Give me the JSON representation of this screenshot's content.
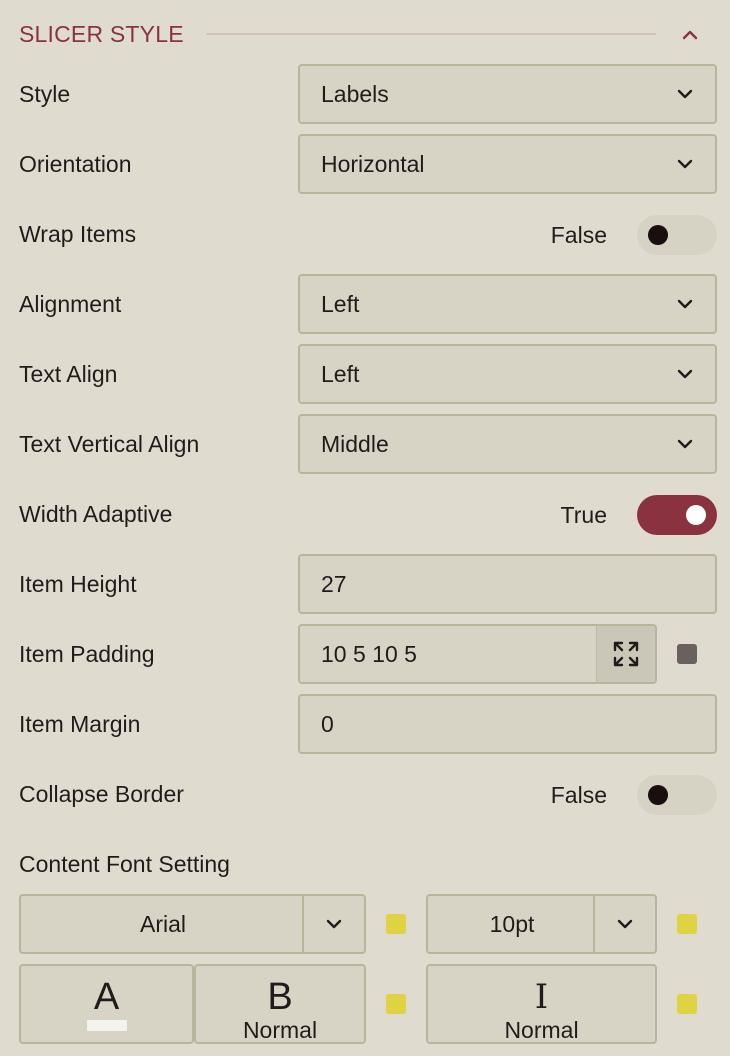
{
  "section": {
    "title": "SLICER STYLE"
  },
  "rows": {
    "style": {
      "label": "Style",
      "value": "Labels"
    },
    "orientation": {
      "label": "Orientation",
      "value": "Horizontal"
    },
    "wrap_items": {
      "label": "Wrap Items",
      "value": "False",
      "on": false
    },
    "alignment": {
      "label": "Alignment",
      "value": "Left"
    },
    "text_align": {
      "label": "Text Align",
      "value": "Left"
    },
    "text_vertical_align": {
      "label": "Text Vertical Align",
      "value": "Middle"
    },
    "width_adaptive": {
      "label": "Width Adaptive",
      "value": "True",
      "on": true
    },
    "item_height": {
      "label": "Item Height",
      "value": "27"
    },
    "item_padding": {
      "label": "Item Padding",
      "value": "10 5 10 5"
    },
    "item_margin": {
      "label": "Item Margin",
      "value": "0"
    },
    "collapse_border": {
      "label": "Collapse Border",
      "value": "False",
      "on": false
    }
  },
  "font": {
    "label": "Content Font Setting",
    "family": "Arial",
    "size": "10pt",
    "color_glyph": "A",
    "bold_glyph": "B",
    "bold_value": "Normal",
    "italic_glyph": "I",
    "italic_value": "Normal"
  },
  "colors": {
    "accent": "#8a3240",
    "background": "#dfdccf",
    "field_bg": "#d7d4c6",
    "field_border": "#b7b59b",
    "indicator_gray": "#6a605d",
    "indicator_yellow": "#dfd343",
    "font_color_swatch": "#f4f4ee"
  },
  "icons": {
    "collapse": "chevron-up-icon",
    "dropdown": "chevron-down-icon",
    "expand": "expand-arrows-icon"
  }
}
